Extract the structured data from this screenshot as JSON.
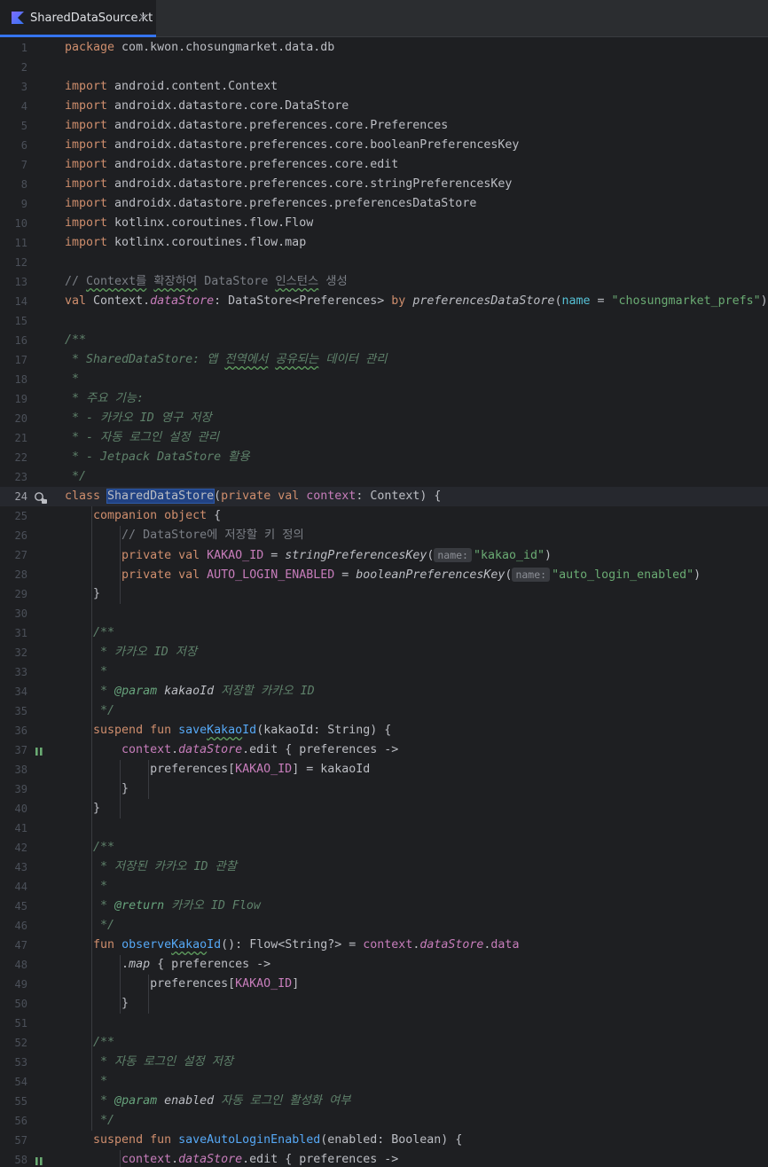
{
  "tab": {
    "filename": "SharedDataSource.kt",
    "close": "×",
    "icon": "kotlin-file-icon"
  },
  "colors": {
    "keyword": "#cf8e6d",
    "string": "#6aab73",
    "function": "#56a8f5",
    "property": "#c77dbb",
    "doc": "#5f826b",
    "comment": "#7a7e85",
    "selection": "#214283",
    "accent": "#3574f0"
  },
  "editor": {
    "current_line": 24,
    "lines": [
      {
        "n": "1",
        "t": [
          {
            "c": "kw",
            "v": "package"
          },
          {
            "v": " com.kwon.chosungmarket.data.db"
          }
        ]
      },
      {
        "n": "2",
        "t": []
      },
      {
        "n": "3",
        "t": [
          {
            "c": "kw",
            "v": "import"
          },
          {
            "v": " android.content.Context"
          }
        ]
      },
      {
        "n": "4",
        "t": [
          {
            "c": "kw",
            "v": "import"
          },
          {
            "v": " androidx.datastore.core.DataStore"
          }
        ]
      },
      {
        "n": "5",
        "t": [
          {
            "c": "kw",
            "v": "import"
          },
          {
            "v": " androidx.datastore.preferences.core.Preferences"
          }
        ]
      },
      {
        "n": "6",
        "t": [
          {
            "c": "kw",
            "v": "import"
          },
          {
            "v": " androidx.datastore.preferences.core.booleanPreferencesKey"
          }
        ]
      },
      {
        "n": "7",
        "t": [
          {
            "c": "kw",
            "v": "import"
          },
          {
            "v": " androidx.datastore.preferences.core.edit"
          }
        ]
      },
      {
        "n": "8",
        "t": [
          {
            "c": "kw",
            "v": "import"
          },
          {
            "v": " androidx.datastore.preferences.core.stringPreferencesKey"
          }
        ]
      },
      {
        "n": "9",
        "t": [
          {
            "c": "kw",
            "v": "import"
          },
          {
            "v": " androidx.datastore.preferences.preferencesDataStore"
          }
        ]
      },
      {
        "n": "10",
        "t": [
          {
            "c": "kw",
            "v": "import"
          },
          {
            "v": " kotlinx.coroutines.flow.Flow"
          }
        ]
      },
      {
        "n": "11",
        "t": [
          {
            "c": "kw",
            "v": "import"
          },
          {
            "v": " kotlinx.coroutines.flow.map"
          }
        ]
      },
      {
        "n": "12",
        "t": []
      },
      {
        "n": "13",
        "t": [
          {
            "c": "cm",
            "v": "// "
          },
          {
            "c": "cm squig",
            "v": "Context를"
          },
          {
            "c": "cm",
            "v": " "
          },
          {
            "c": "cm squig",
            "v": "확장하여"
          },
          {
            "c": "cm",
            "v": " DataStore "
          },
          {
            "c": "cm squig",
            "v": "인스턴스"
          },
          {
            "c": "cm",
            "v": " 생성"
          }
        ]
      },
      {
        "n": "14",
        "t": [
          {
            "c": "kw",
            "v": "val"
          },
          {
            "v": " Context."
          },
          {
            "c": "propi",
            "v": "dataStore"
          },
          {
            "v": ": DataStore<Preferences> "
          },
          {
            "c": "kw",
            "v": "by"
          },
          {
            "v": " "
          },
          {
            "c": "ext",
            "v": "preferencesDataStore"
          },
          {
            "v": "("
          },
          {
            "c": "param",
            "v": "name"
          },
          {
            "v": " = "
          },
          {
            "c": "str",
            "v": "\"chosungmarket_prefs\""
          },
          {
            "v": ")"
          }
        ]
      },
      {
        "n": "15",
        "t": []
      },
      {
        "n": "16",
        "t": [
          {
            "c": "dc",
            "v": "/**"
          }
        ]
      },
      {
        "n": "17",
        "t": [
          {
            "c": "dc",
            "v": " * SharedDataStore: 앱 "
          },
          {
            "c": "dc squig",
            "v": "전역에서"
          },
          {
            "c": "dc",
            "v": " "
          },
          {
            "c": "dc squig",
            "v": "공유되는"
          },
          {
            "c": "dc",
            "v": " 데이터 관리"
          }
        ]
      },
      {
        "n": "18",
        "t": [
          {
            "c": "dc",
            "v": " *"
          }
        ]
      },
      {
        "n": "19",
        "t": [
          {
            "c": "dc",
            "v": " * 주요 기능:"
          }
        ]
      },
      {
        "n": "20",
        "t": [
          {
            "c": "dc",
            "v": " * - 카카오 ID 영구 저장"
          }
        ]
      },
      {
        "n": "21",
        "t": [
          {
            "c": "dc",
            "v": " * - 자동 로그인 설정 관리"
          }
        ]
      },
      {
        "n": "22",
        "t": [
          {
            "c": "dc",
            "v": " * - Jetpack DataStore 활용"
          }
        ]
      },
      {
        "n": "23",
        "t": [
          {
            "c": "dc",
            "v": " */"
          }
        ]
      },
      {
        "n": "24",
        "g": "override",
        "t": [
          {
            "c": "kw",
            "v": "class"
          },
          {
            "v": " "
          },
          {
            "c": "cls sel",
            "v": "SharedDataStore"
          },
          {
            "v": "("
          },
          {
            "c": "kw",
            "v": "private"
          },
          {
            "v": " "
          },
          {
            "c": "kw",
            "v": "val"
          },
          {
            "v": " "
          },
          {
            "c": "prop",
            "v": "context"
          },
          {
            "v": ": Context) {"
          }
        ]
      },
      {
        "n": "25",
        "t": [
          {
            "v": "    "
          },
          {
            "c": "kw",
            "v": "companion object"
          },
          {
            "v": " {"
          }
        ]
      },
      {
        "n": "26",
        "t": [
          {
            "v": "        "
          },
          {
            "c": "cm",
            "v": "// DataStore에 저장할 키 정의"
          }
        ]
      },
      {
        "n": "27",
        "t": [
          {
            "v": "        "
          },
          {
            "c": "kw",
            "v": "private"
          },
          {
            "v": " "
          },
          {
            "c": "kw",
            "v": "val"
          },
          {
            "v": " "
          },
          {
            "c": "prop",
            "v": "KAKAO_ID"
          },
          {
            "v": " = "
          },
          {
            "c": "ext",
            "v": "stringPreferencesKey"
          },
          {
            "v": "("
          },
          {
            "c": "hint",
            "v": "name:"
          },
          {
            "c": "str",
            "v": "\"kakao_id\""
          },
          {
            "v": ")"
          }
        ]
      },
      {
        "n": "28",
        "t": [
          {
            "v": "        "
          },
          {
            "c": "kw",
            "v": "private"
          },
          {
            "v": " "
          },
          {
            "c": "kw",
            "v": "val"
          },
          {
            "v": " "
          },
          {
            "c": "prop",
            "v": "AUTO_LOGIN_ENABLED"
          },
          {
            "v": " = "
          },
          {
            "c": "ext",
            "v": "booleanPreferencesKey"
          },
          {
            "v": "("
          },
          {
            "c": "hint",
            "v": "name:"
          },
          {
            "c": "str",
            "v": "\"auto_login_enabled\""
          },
          {
            "v": ")"
          }
        ]
      },
      {
        "n": "29",
        "t": [
          {
            "v": "    }"
          }
        ]
      },
      {
        "n": "30",
        "t": []
      },
      {
        "n": "31",
        "t": [
          {
            "v": "    "
          },
          {
            "c": "dc",
            "v": "/**"
          }
        ]
      },
      {
        "n": "32",
        "t": [
          {
            "v": "    "
          },
          {
            "c": "dc",
            "v": " * 카카오 ID 저장"
          }
        ]
      },
      {
        "n": "33",
        "t": [
          {
            "v": "    "
          },
          {
            "c": "dc",
            "v": " *"
          }
        ]
      },
      {
        "n": "34",
        "t": [
          {
            "v": "    "
          },
          {
            "c": "dc",
            "v": " * "
          },
          {
            "c": "dtag",
            "v": "@param"
          },
          {
            "c": "dref",
            "v": " kakaoId"
          },
          {
            "c": "dc",
            "v": " 저장할 카카오 ID"
          }
        ]
      },
      {
        "n": "35",
        "t": [
          {
            "v": "    "
          },
          {
            "c": "dc",
            "v": " */"
          }
        ]
      },
      {
        "n": "36",
        "t": [
          {
            "v": "    "
          },
          {
            "c": "kw",
            "v": "suspend fun"
          },
          {
            "v": " "
          },
          {
            "c": "fn",
            "v": "save"
          },
          {
            "c": "fn squig",
            "v": "Kakao"
          },
          {
            "c": "fn",
            "v": "Id"
          },
          {
            "v": "(kakaoId: String) {"
          }
        ]
      },
      {
        "n": "37",
        "g": "suspend",
        "t": [
          {
            "v": "        "
          },
          {
            "c": "prop",
            "v": "context"
          },
          {
            "v": "."
          },
          {
            "c": "propi",
            "v": "dataStore"
          },
          {
            "v": ".edit { preferences ->"
          }
        ]
      },
      {
        "n": "38",
        "t": [
          {
            "v": "            preferences["
          },
          {
            "c": "prop",
            "v": "KAKAO_ID"
          },
          {
            "v": "] = kakaoId"
          }
        ]
      },
      {
        "n": "39",
        "t": [
          {
            "v": "        }"
          }
        ]
      },
      {
        "n": "40",
        "t": [
          {
            "v": "    }"
          }
        ]
      },
      {
        "n": "41",
        "t": []
      },
      {
        "n": "42",
        "t": [
          {
            "v": "    "
          },
          {
            "c": "dc",
            "v": "/**"
          }
        ]
      },
      {
        "n": "43",
        "t": [
          {
            "v": "    "
          },
          {
            "c": "dc",
            "v": " * 저장된 카카오 ID 관찰"
          }
        ]
      },
      {
        "n": "44",
        "t": [
          {
            "v": "    "
          },
          {
            "c": "dc",
            "v": " *"
          }
        ]
      },
      {
        "n": "45",
        "t": [
          {
            "v": "    "
          },
          {
            "c": "dc",
            "v": " * "
          },
          {
            "c": "dtag",
            "v": "@return"
          },
          {
            "c": "dc",
            "v": " 카카오 ID Flow"
          }
        ]
      },
      {
        "n": "46",
        "t": [
          {
            "v": "    "
          },
          {
            "c": "dc",
            "v": " */"
          }
        ]
      },
      {
        "n": "47",
        "t": [
          {
            "v": "    "
          },
          {
            "c": "kw",
            "v": "fun"
          },
          {
            "v": " "
          },
          {
            "c": "fn",
            "v": "observe"
          },
          {
            "c": "fn squig",
            "v": "Kakao"
          },
          {
            "c": "fn",
            "v": "Id"
          },
          {
            "v": "(): Flow<String?> = "
          },
          {
            "c": "prop",
            "v": "context"
          },
          {
            "v": "."
          },
          {
            "c": "propi",
            "v": "dataStore"
          },
          {
            "v": "."
          },
          {
            "c": "prop",
            "v": "data"
          }
        ]
      },
      {
        "n": "48",
        "t": [
          {
            "v": "        ."
          },
          {
            "c": "ext",
            "v": "map"
          },
          {
            "v": " { preferences ->"
          }
        ]
      },
      {
        "n": "49",
        "t": [
          {
            "v": "            preferences["
          },
          {
            "c": "prop",
            "v": "KAKAO_ID"
          },
          {
            "v": "]"
          }
        ]
      },
      {
        "n": "50",
        "t": [
          {
            "v": "        }"
          }
        ]
      },
      {
        "n": "51",
        "t": []
      },
      {
        "n": "52",
        "t": [
          {
            "v": "    "
          },
          {
            "c": "dc",
            "v": "/**"
          }
        ]
      },
      {
        "n": "53",
        "t": [
          {
            "v": "    "
          },
          {
            "c": "dc",
            "v": " * 자동 로그인 설정 저장"
          }
        ]
      },
      {
        "n": "54",
        "t": [
          {
            "v": "    "
          },
          {
            "c": "dc",
            "v": " *"
          }
        ]
      },
      {
        "n": "55",
        "t": [
          {
            "v": "    "
          },
          {
            "c": "dc",
            "v": " * "
          },
          {
            "c": "dtag",
            "v": "@param"
          },
          {
            "c": "dref",
            "v": " enabled"
          },
          {
            "c": "dc",
            "v": " 자동 로그인 활성화 여부"
          }
        ]
      },
      {
        "n": "56",
        "t": [
          {
            "v": "    "
          },
          {
            "c": "dc",
            "v": " */"
          }
        ]
      },
      {
        "n": "57",
        "t": [
          {
            "v": "    "
          },
          {
            "c": "kw",
            "v": "suspend fun"
          },
          {
            "v": " "
          },
          {
            "c": "fn",
            "v": "saveAutoLoginEnabled"
          },
          {
            "v": "(enabled: Boolean) {"
          }
        ]
      },
      {
        "n": "58",
        "g": "suspend",
        "t": [
          {
            "v": "        "
          },
          {
            "c": "prop",
            "v": "context"
          },
          {
            "v": "."
          },
          {
            "c": "propi",
            "v": "dataStore"
          },
          {
            "v": ".edit { preferences ->"
          }
        ]
      }
    ]
  }
}
